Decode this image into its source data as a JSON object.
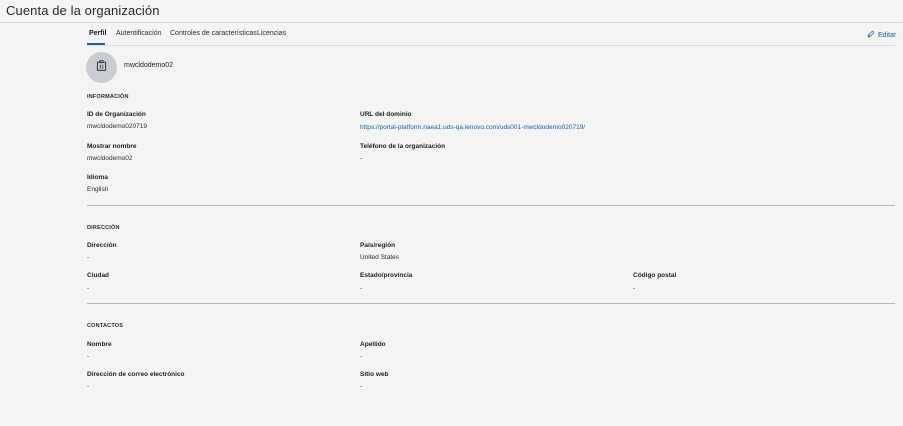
{
  "page": {
    "title": "Cuenta de la organización"
  },
  "tabs": [
    {
      "label": "Perfil",
      "active": true
    },
    {
      "label": "Autentificación",
      "active": false
    },
    {
      "label": "Controles de características",
      "active": false
    },
    {
      "label": "Licencias",
      "active": false
    }
  ],
  "actions": {
    "edit_label": "Editar",
    "edit_icon": "pencil-icon"
  },
  "profile": {
    "org_name": "mwcldodemo02",
    "avatar_icon": "building-icon"
  },
  "info": {
    "title": "INFORMACIÓN",
    "org_id_label": "ID de Organización",
    "org_id_value": "mwcldodemo020719",
    "domain_url_label": "URL del dominio",
    "domain_url_value": "https://portal-platform.naea1.uds-qa.lenovo.com/uds001-mwcldodemo020719/",
    "display_name_label": "Mostrar nombre",
    "display_name_value": "mwcldodemo02",
    "phone_label": "Teléfono de la organización",
    "phone_value": "-",
    "language_label": "Idioma",
    "language_value": "English"
  },
  "address": {
    "title": "DIRECCIÓN",
    "address_label": "Dirección",
    "address_value": "-",
    "country_label": "País/región",
    "country_value": "United States",
    "city_label": "Ciudad",
    "city_value": "-",
    "state_label": "Estado/provincia",
    "state_value": "-",
    "postal_label": "Código postal",
    "postal_value": "-"
  },
  "contacts": {
    "title": "CONTACTOS",
    "first_name_label": "Nombre",
    "first_name_value": "-",
    "last_name_label": "Apellido",
    "last_name_value": "-",
    "email_label": "Dirección de correo electrónico",
    "email_value": "-",
    "website_label": "Sitio web",
    "website_value": "-"
  },
  "colors": {
    "accent": "#1a5fa8",
    "background": "#f4f4f5",
    "avatar_bg": "#c9ccd1"
  }
}
